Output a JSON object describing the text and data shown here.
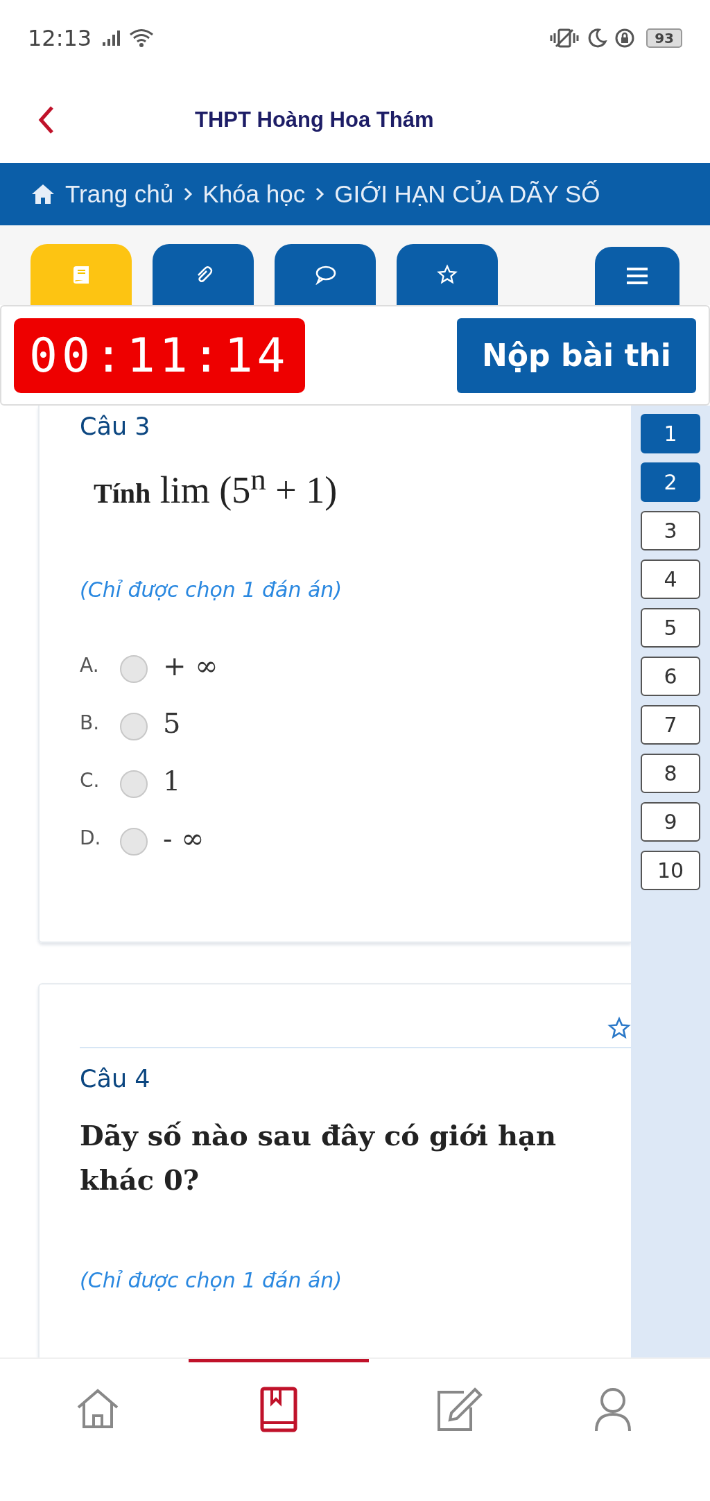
{
  "status_bar": {
    "time": "12:13",
    "battery": "93"
  },
  "header": {
    "title": "THPT Hoàng Hoa Thám"
  },
  "breadcrumb": [
    "Trang chủ",
    "Khóa học",
    "GIỚI HẠN CỦA DÃY SỐ"
  ],
  "tabs": [
    {
      "kind": "book",
      "selected": true
    },
    {
      "kind": "clip",
      "selected": false
    },
    {
      "kind": "chat",
      "selected": false
    },
    {
      "kind": "star",
      "selected": false
    },
    {
      "kind": "menu",
      "selected": false
    }
  ],
  "timer": "00:11:14",
  "submit_button": "Nộp bài thi",
  "questions": [
    {
      "title": "Câu 3",
      "text": "**Tính** lim (5$^{n}$ + 1)",
      "kind": "math",
      "hint": "(Chỉ được chọn 1 đán án)",
      "options": [
        {
          "letter": "A.",
          "value": "+ ∞",
          "selected": false
        },
        {
          "letter": "B.",
          "value": "5",
          "selected": false
        },
        {
          "letter": "C.",
          "value": "1",
          "selected": false
        },
        {
          "letter": "D.",
          "value": "- ∞",
          "selected": false
        }
      ]
    },
    {
      "title": "Câu 4",
      "starred": false,
      "text": "Dãy số nào sau đây có giới hạn khác 0?",
      "kind": "text",
      "hint": "(Chỉ được chọn 1 đán án)"
    }
  ],
  "question_nav": [
    {
      "label": "1",
      "answered": true
    },
    {
      "label": "2",
      "answered": true
    },
    {
      "label": "3",
      "answered": false
    },
    {
      "label": "4",
      "answered": false
    },
    {
      "label": "5",
      "answered": false
    },
    {
      "label": "6",
      "answered": false
    },
    {
      "label": "7",
      "answered": false
    },
    {
      "label": "8",
      "answered": false
    },
    {
      "label": "9",
      "answered": false
    },
    {
      "label": "10",
      "answered": false
    }
  ],
  "bottom_nav": [
    {
      "kind": "home",
      "selected": false
    },
    {
      "kind": "book",
      "selected": true
    },
    {
      "kind": "edit",
      "selected": false
    },
    {
      "kind": "user",
      "selected": false
    }
  ]
}
